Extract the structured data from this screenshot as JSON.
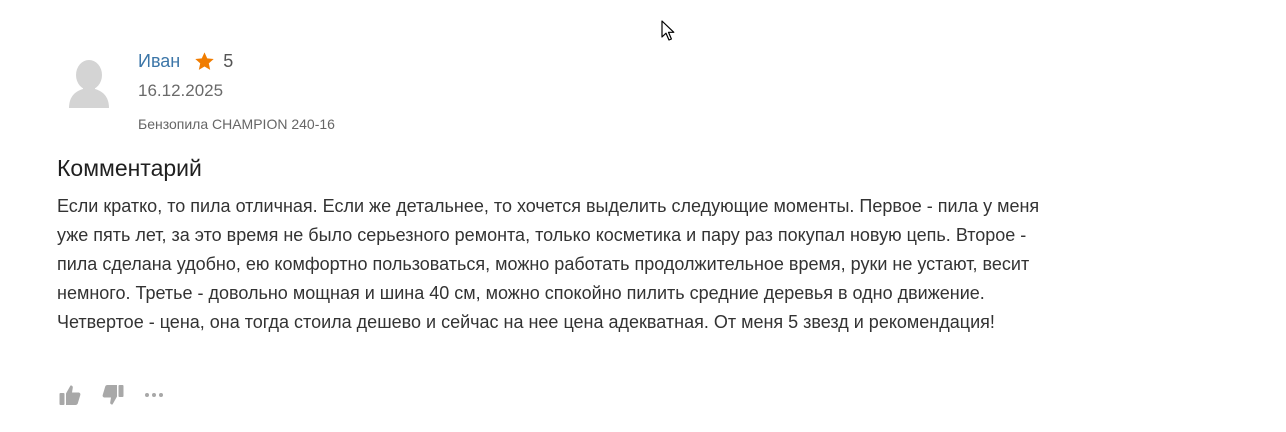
{
  "review": {
    "author": "Иван",
    "rating": "5",
    "date": "16.12.2025",
    "product": "Бензопила CHAMPION 240-16",
    "comment_heading": "Комментарий",
    "comment_text": "Если кратко, то пила отличная. Если же детальнее, то хочется выделить следующие моменты. Первое - пила у меня уже пять лет, за это время не было серьезного ремонта, только косметика и пару раз покупал новую цепь. Второе - пила сделана удобно, ею комфортно пользоваться, можно работать продолжительное время, руки не устают, весит немного. Третье - довольно мощная и шина 40 см, можно спокойно пилить средние деревья в одно движение. Четвертое - цена, она тогда стоила дешево и сейчас на нее цена адекватная. От меня 5 звезд и рекомендация!"
  },
  "icons": {
    "avatar": "user-silhouette-icon",
    "star": "star-icon",
    "like": "thumbs-up-icon",
    "dislike": "thumbs-down-icon",
    "more": "more-horizontal-icon",
    "cursor": "mouse-pointer-icon"
  },
  "colors": {
    "author_link": "#3c76a8",
    "star": "#f07c00",
    "icon_gray": "#a8a8a8",
    "avatar_gray": "#d4d4d4"
  }
}
